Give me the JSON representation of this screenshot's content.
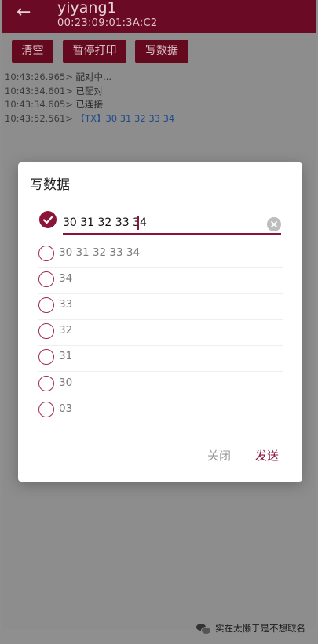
{
  "header": {
    "back_icon": "arrow-left-icon",
    "title": "yiyang1",
    "subtitle": "00:23:09:01:3A:C2"
  },
  "toolbar": {
    "clear_label": "清空",
    "pause_print_label": "暂停打印",
    "write_data_label": "写数据"
  },
  "log": [
    {
      "time": "10:43:26.965>",
      "text": "配对中..."
    },
    {
      "time": "10:43:34.601>",
      "text": "已配对"
    },
    {
      "time": "10:43:34.605>",
      "text": "已连接"
    },
    {
      "time": "10:43:52.561>",
      "text": "【TX】30 31 32 33 34"
    }
  ],
  "dialog": {
    "title": "写数据",
    "input_value": "30 31 32 33 34",
    "options": [
      "30 31 32 33 34",
      "34",
      "33",
      "32",
      "31",
      "30",
      "03"
    ],
    "close_label": "关闭",
    "send_label": "发送"
  },
  "watermark": "实在太懒于是不想取名",
  "colors": {
    "accent": "#8b1538",
    "appbar": "#6b0a24",
    "scrim": "#8d8d8d"
  }
}
